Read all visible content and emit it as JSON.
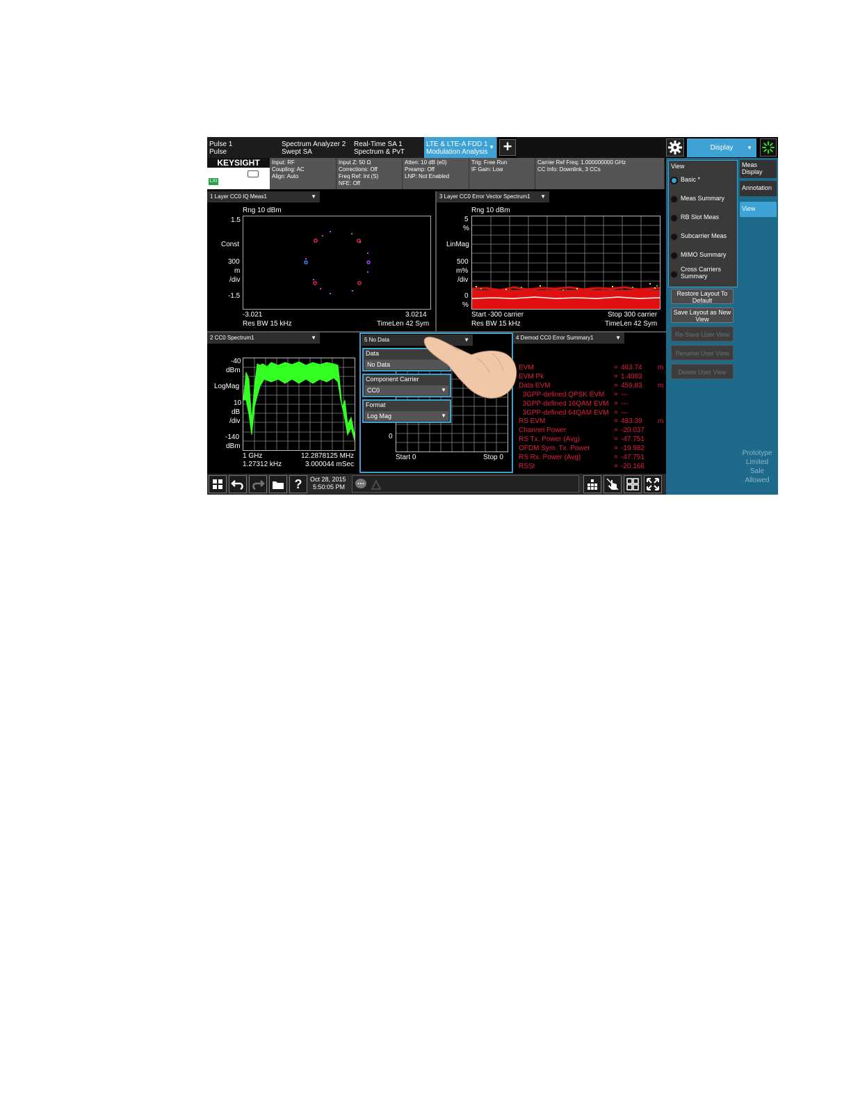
{
  "tabs": [
    {
      "line1": "Pulse 1",
      "line2": "Pulse"
    },
    {
      "line1": "Spectrum Analyzer 2",
      "line2": "Swept SA"
    },
    {
      "line1": "Real-Time SA 1",
      "line2": "Spectrum & PvT"
    },
    {
      "line1": "LTE & LTE-A FDD 1",
      "line2": "Modulation Analysis"
    }
  ],
  "header": {
    "display_label": "Display",
    "brand": "KEYSIGHT",
    "lxi": "LXI"
  },
  "status": {
    "col1": [
      "Input: RF",
      "Coupling: AC",
      "Align: Auto"
    ],
    "col2": [
      "Input Z: 50 Ω",
      "Corrections: Off",
      "Freq Ref: Int (S)",
      "NFE: Off"
    ],
    "col3": [
      "Atten: 10 dB (e0)",
      "Preamp: Off",
      "LNP: Not Enabled"
    ],
    "col4": [
      "Trig: Free Run",
      "IF Gain: Low"
    ],
    "col5": [
      "Carrier Ref Freq: 1.000000000 GHz",
      "CC Info: Downlink, 3 CCs"
    ]
  },
  "win1": {
    "title": "1 Layer CC0 IQ Meas1",
    "rng": "Rng 10 dBm",
    "y_top": "1.5",
    "y_const": "Const",
    "y_scale1": "300",
    "y_scale2": "m",
    "y_scale3": "/div",
    "y_bot": "-1.5",
    "x_left": "-3.021",
    "x_right": "3.0214",
    "res_bw": "Res BW 15 kHz",
    "timelen": "TimeLen 42  Sym"
  },
  "win3": {
    "title": "3 Layer CC0 Error Vector Spectrum1",
    "rng": "Rng 10 dBm",
    "y_top": "5",
    "y_top_unit": "%",
    "y_scale": "LinMag",
    "y_div1": "500",
    "y_div2": "m%",
    "y_div3": "/div",
    "y_bot": "0",
    "y_bot_unit": "%",
    "x_start": "Start -300  carrier",
    "x_stop": "Stop 300  carrier",
    "res_bw": "Res BW 15 kHz",
    "timelen": "TimeLen 42  Sym"
  },
  "win2": {
    "title": "2 CC0 Spectrum1",
    "y_top": "-40",
    "y_top_unit": "dBm",
    "y_scale": "LogMag",
    "y_div1": "10",
    "y_div2": "dB",
    "y_div3": "/div",
    "y_bot": "-140",
    "y_bot_unit": "dBm",
    "x_left": "1 GHz",
    "x_right": "12.2878125 MHz",
    "x_left2": "1.27312 kHz",
    "x_right2": "3.000044 mSec"
  },
  "win5": {
    "title": "5 No Data",
    "y_bot": "0",
    "x_start": "Start 0",
    "x_stop": "Stop 0",
    "menu": [
      {
        "label": "Data",
        "value": "No Data"
      },
      {
        "label": "Component Carrier",
        "value": "CC0"
      },
      {
        "label": "Format",
        "value": "Log Mag"
      }
    ]
  },
  "win4": {
    "title": "4 Demod CC0 Error Summary1",
    "rows": [
      {
        "name": "EVM",
        "eq": "=",
        "value": "463.74",
        "unit": "m"
      },
      {
        "name": "EVM Pk",
        "eq": "=",
        "value": "1.4083",
        "unit": ""
      },
      {
        "name": "Data EVM",
        "eq": "=",
        "value": "459.83",
        "unit": "m"
      },
      {
        "name": "  3GPP-defined QPSK EVM",
        "eq": "=",
        "value": "---",
        "unit": ""
      },
      {
        "name": "  3GPP-defined 16QAM EVM",
        "eq": "=",
        "value": "---",
        "unit": ""
      },
      {
        "name": "  3GPP-defined 64QAM EVM",
        "eq": "=",
        "value": "---",
        "unit": ""
      },
      {
        "name": "RS EVM",
        "eq": "=",
        "value": "483.39",
        "unit": "m"
      },
      {
        "name": "Channel Power",
        "eq": "=",
        "value": "-20.037",
        "unit": ""
      },
      {
        "name": "RS Tx. Power (Avg)",
        "eq": "=",
        "value": "-47.751",
        "unit": ""
      },
      {
        "name": "OFDM Sym. Tx. Power",
        "eq": "=",
        "value": "-19.982",
        "unit": ""
      },
      {
        "name": "RS Rx. Power (Avg)",
        "eq": "=",
        "value": "-47.751",
        "unit": ""
      },
      {
        "name": "RSSI",
        "eq": "=",
        "value": "-20.166",
        "unit": ""
      }
    ]
  },
  "panel": {
    "view_label": "View",
    "radios": [
      {
        "label": "Basic *",
        "selected": true
      },
      {
        "label": "Meas Summary",
        "selected": false
      },
      {
        "label": "RB Slot Meas",
        "selected": false
      },
      {
        "label": "Subcarrier Meas",
        "selected": false
      },
      {
        "label": "MIMO Summary",
        "selected": false
      },
      {
        "label": "Cross Carriers Summary",
        "selected": false
      }
    ],
    "buttons": [
      {
        "label": "Restore Layout To Default",
        "enabled": true
      },
      {
        "label": "Save Layout as New View",
        "enabled": true
      },
      {
        "label": "Re-Save User View",
        "enabled": false
      },
      {
        "label": "Rename User View",
        "enabled": false
      },
      {
        "label": "Delete User View",
        "enabled": false
      }
    ],
    "category_tabs": [
      "Meas Display",
      "Annotation",
      "View"
    ],
    "prototype": [
      "Prototype",
      "Limited",
      "Sale",
      "Allowed"
    ]
  },
  "taskbar": {
    "date": "Oct 28, 2015",
    "time": "5:50:05 PM"
  },
  "colors": {
    "accent": "#3ea2d4",
    "trace_green": "#33ff22",
    "error_red": "#e0203c",
    "panel_bg": "#1e6a8a"
  }
}
